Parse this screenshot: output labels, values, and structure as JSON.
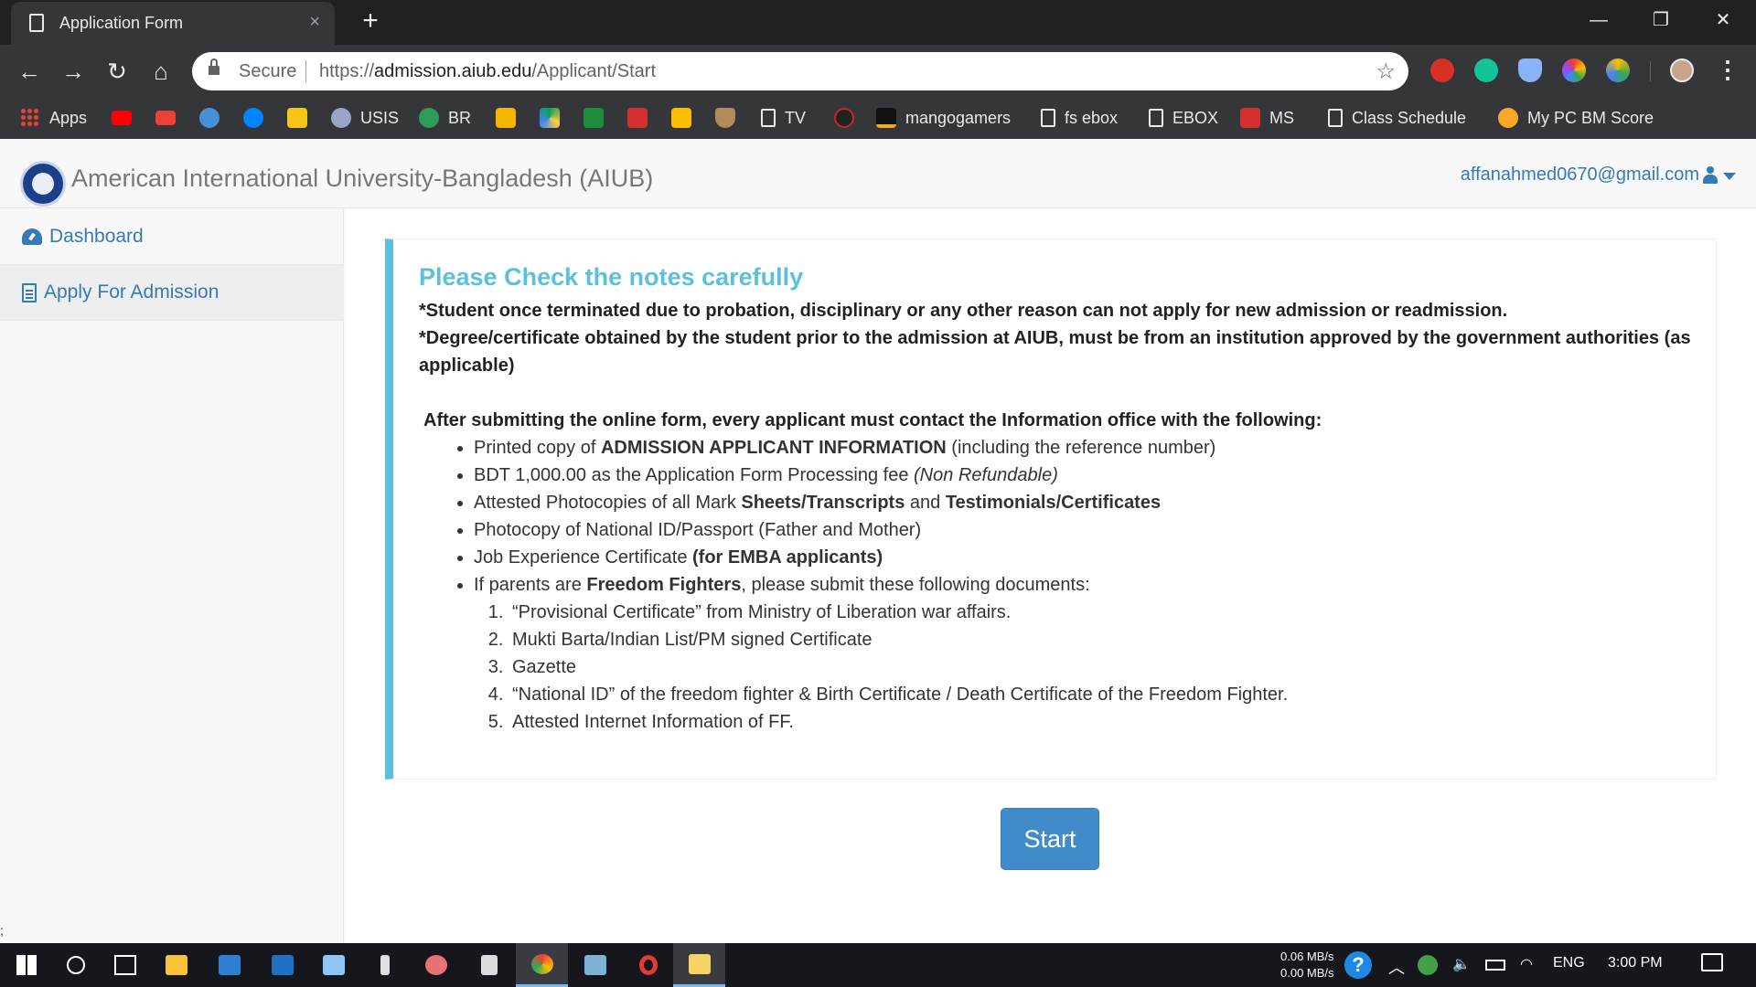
{
  "browser": {
    "tab_title": "Application Form",
    "tab_close": "×",
    "new_tab": "+",
    "window_minimize": "—",
    "window_restore": "❐",
    "window_close": "✕",
    "nav_back": "←",
    "nav_forward": "→",
    "nav_reload": "↻",
    "nav_home": "⌂",
    "secure_label": "Secure",
    "url_scheme": "https://",
    "url_host": "admission.aiub.edu",
    "url_path": "/Applicant/Start",
    "bookmark_star": "☆",
    "menu": "⋮"
  },
  "bookmarks": {
    "apps": "Apps",
    "usis": "USIS",
    "br": "BR",
    "tv": "TV",
    "mangogamers": "mangogamers",
    "fs_ebox": "fs ebox",
    "ebox": "EBOX",
    "ms": "MS",
    "class_schedule": "Class Schedule",
    "bm_score": "My PC BM Score"
  },
  "header": {
    "brand": "American International University-Bangladesh (AIUB)",
    "user_email": "affanahmed0670@gmail.com"
  },
  "sidebar": {
    "items": [
      {
        "label": "Dashboard"
      },
      {
        "label": "Apply For Admission"
      }
    ]
  },
  "notes": {
    "heading": "Please Check the notes carefully",
    "rule1": "*Student once terminated due to probation, disciplinary or any other reason can not apply for new admission or readmission.",
    "rule2": "*Degree/certificate obtained by the student prior to the admission at AIUB, must be from an institution approved by the government authorities (as  applicable)",
    "lead": "After submitting the online form, every applicant must contact the Information office with the following:",
    "b1_pre": "Printed copy of ",
    "b1_bold": "ADMISSION APPLICANT INFORMATION",
    "b1_post": " (including the reference number)",
    "b2_pre": "BDT 1,000.00 as the Application Form Processing fee ",
    "b2_italic": "(Non Refundable)",
    "b3_pre": "Attested Photocopies of all Mark ",
    "b3_bold1": "Sheets/Transcripts",
    "b3_mid": " and ",
    "b3_bold2": "Testimonials/Certificates",
    "b4": "Photocopy of National ID/Passport (Father and Mother)",
    "b5_pre": "Job Experience Certificate ",
    "b5_bold": "(for EMBA applicants)",
    "b6_pre": "If parents are ",
    "b6_bold": "Freedom Fighters",
    "b6_post": ", please submit these following documents:",
    "ff_docs": [
      "“Provisional Certificate” from Ministry of Liberation war affairs.",
      "Mukti Barta/Indian List/PM signed Certificate",
      "Gazette",
      "“National ID” of the freedom fighter & Birth Certificate / Death Certificate of the Freedom Fighter.",
      "Attested Internet Information of FF."
    ]
  },
  "start_button": "Start",
  "stray_text": ";",
  "taskbar": {
    "net_up": "0.06 MB/s",
    "net_down": "0.00 MB/s",
    "help": "?",
    "lang": "ENG",
    "time": "3:00 PM"
  },
  "colors": {
    "accent": "#337ab7",
    "info": "#5bc0de",
    "button": "#428bca",
    "chrome_dark": "#35363a"
  }
}
